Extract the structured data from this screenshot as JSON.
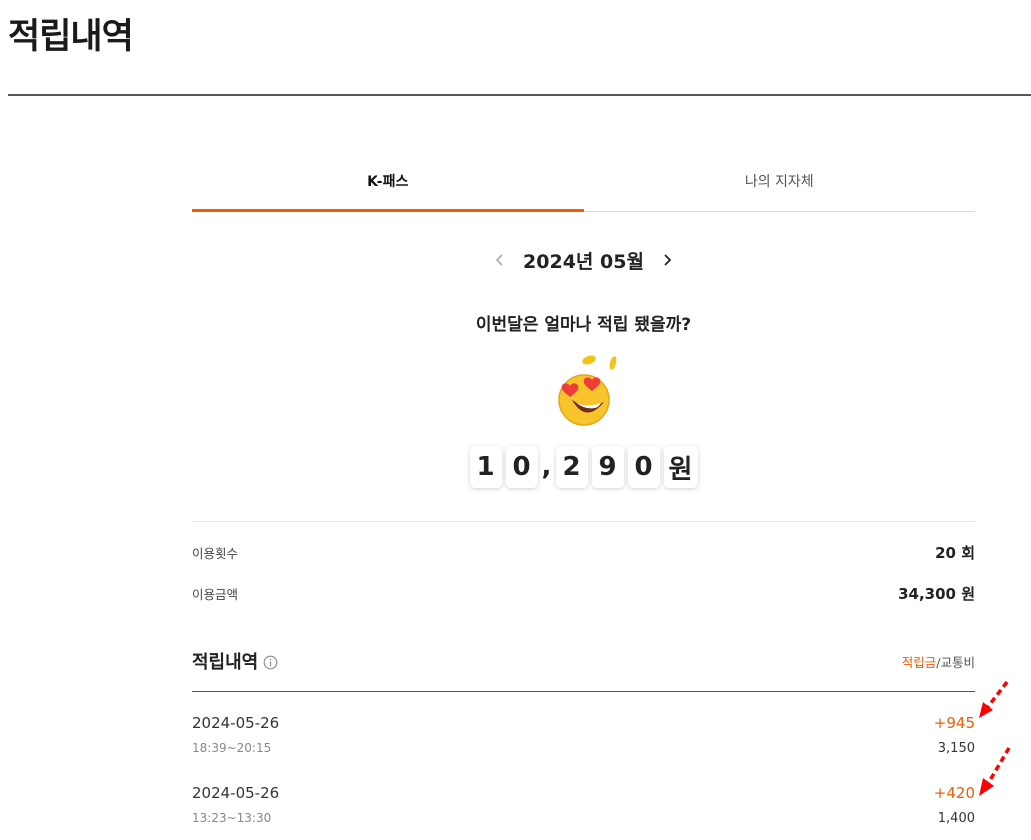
{
  "page": {
    "title": "적립내역"
  },
  "tabs": [
    {
      "label": "K-패스",
      "active": true
    },
    {
      "label": "나의 지자체",
      "active": false
    }
  ],
  "month_nav": {
    "label": "2024년 05월",
    "prev_icon": "chevron-left-icon",
    "next_icon": "chevron-right-icon"
  },
  "summary": {
    "question": "이번달은 얼마나 적립 됐을까?",
    "emoji": "heart-eyes-coin-emoji",
    "amount_chars": [
      "1",
      "0",
      ",",
      "2",
      "9",
      "0",
      "원"
    ]
  },
  "stats": [
    {
      "label": "이용횟수",
      "value": "20 회"
    },
    {
      "label": "이용금액",
      "value": "34,300 원"
    }
  ],
  "history": {
    "title": "적립내역",
    "info_icon": "info-circle-icon",
    "legend_accent": "적립금",
    "legend_rest": "/교통비",
    "entries": [
      {
        "date": "2024-05-26",
        "time": "18:39~20:15",
        "points": "+945",
        "fare": "3,150"
      },
      {
        "date": "2024-05-26",
        "time": "13:23~13:30",
        "points": "+420",
        "fare": "1,400"
      }
    ]
  },
  "colors": {
    "accent": "#f25c05",
    "annotation": "#ff0000"
  }
}
